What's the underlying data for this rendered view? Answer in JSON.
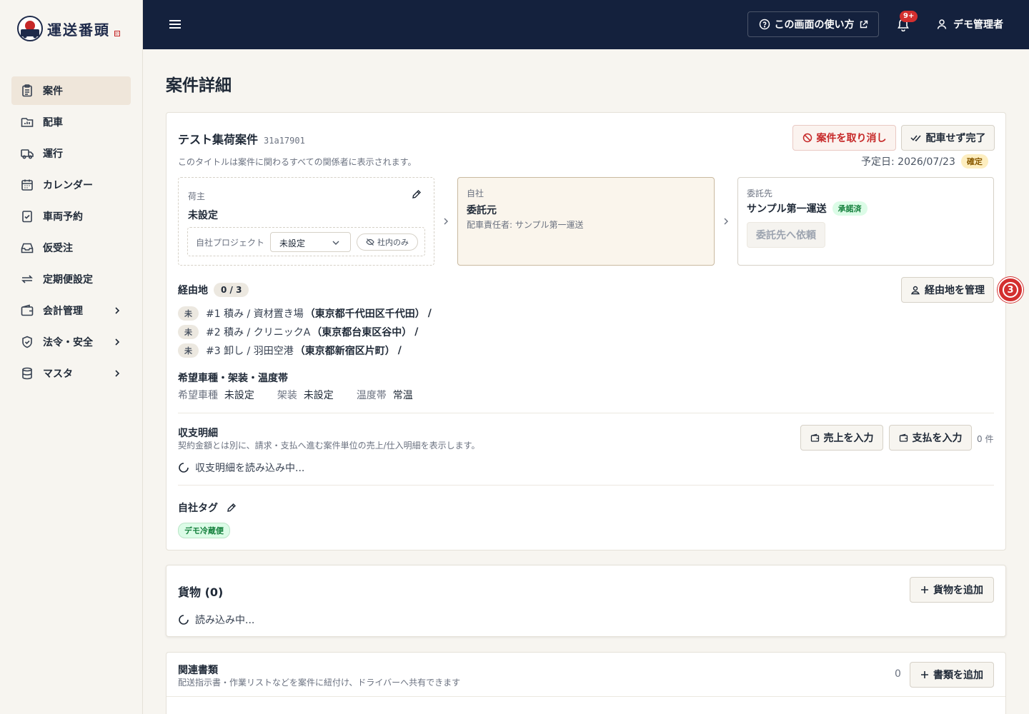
{
  "app": {
    "logo_text": "運送番頭",
    "logo_seal": "印"
  },
  "sidebar": {
    "items": [
      {
        "label": "案件",
        "icon": "clipboard-icon",
        "active": true
      },
      {
        "label": "配車",
        "icon": "folder-chart-icon"
      },
      {
        "label": "運行",
        "icon": "truck-icon"
      },
      {
        "label": "カレンダー",
        "icon": "calendar-icon"
      },
      {
        "label": "車両予約",
        "icon": "clipboard-check-icon"
      },
      {
        "label": "仮受注",
        "icon": "inbox-icon"
      },
      {
        "label": "定期便設定",
        "icon": "repeat-icon"
      },
      {
        "label": "会計管理",
        "icon": "wallet-icon",
        "expandable": true
      },
      {
        "label": "法令・安全",
        "icon": "shield-icon",
        "expandable": true
      },
      {
        "label": "マスタ",
        "icon": "database-icon",
        "expandable": true
      }
    ]
  },
  "header": {
    "help_label": "この画面の使い方",
    "notification_badge": "9+",
    "user_name": "デモ管理者"
  },
  "page": {
    "title": "案件詳細"
  },
  "job": {
    "title": "テスト集荷案件",
    "id": "31a17901",
    "subtitle": "このタイトルは案件に関わるすべての関係者に表示されます。",
    "cancel_label": "案件を取り消し",
    "complete_label": "配車せず完了",
    "date_label": "予定日: 2026/07/23",
    "date_badge": "確定",
    "shipper": {
      "heading": "荷主",
      "value": "未設定",
      "project_label": "自社プロジェクト",
      "project_value": "未設定",
      "internal_label": "社内のみ"
    },
    "own": {
      "heading": "自社",
      "value": "委託元",
      "manager": "配車責任者: サンプル第一運送"
    },
    "contractor": {
      "heading": "委託先",
      "value": "サンプル第一運送",
      "status": "承諾済",
      "request_label": "委託先へ依頼"
    },
    "waypoints": {
      "heading": "経由地",
      "count": "0 / 3",
      "manage_label": "経由地を管理",
      "step_marker": "3",
      "items": [
        {
          "status": "未",
          "text": "#1 積み / 資材置き場",
          "address": "（東京都千代田区千代田）",
          "sep": "/"
        },
        {
          "status": "未",
          "text": "#2 積み / クリニックA",
          "address": "（東京都台東区谷中）",
          "sep": "/"
        },
        {
          "status": "未",
          "text": "#3 卸し / 羽田空港",
          "address": "（東京都新宿区片町）",
          "sep": "/"
        }
      ]
    },
    "vehicle": {
      "heading": "希望車種・架装・温度帯",
      "fields": [
        {
          "label": "希望車種",
          "value": "未設定"
        },
        {
          "label": "架装",
          "value": "未設定"
        },
        {
          "label": "温度帯",
          "value": "常温"
        }
      ]
    },
    "finance": {
      "heading": "収支明細",
      "desc": "契約金額とは別に、請求・支払へ進む案件単位の売上/仕入明細を表示します。",
      "sales_label": "売上を入力",
      "payment_label": "支払を入力",
      "count": "0 件",
      "loading": "収支明細を読み込み中..."
    },
    "tags": {
      "heading": "自社タグ",
      "items": [
        "デモ冷蔵便"
      ]
    }
  },
  "cargo": {
    "title": "貨物 (0)",
    "add_label": "貨物を追加",
    "loading": "読み込み中..."
  },
  "docs": {
    "title": "関連書類",
    "desc": "配送指示書・作業リストなどを案件に紐付け、ドライバーへ共有できます",
    "count": "0",
    "add_label": "書類を追加"
  },
  "colors": {
    "navy": "#14213d",
    "accent_red": "#c62828",
    "badge_red": "#d32f2f",
    "green": "#15803d",
    "confirm_bg": "#fdeec0"
  }
}
